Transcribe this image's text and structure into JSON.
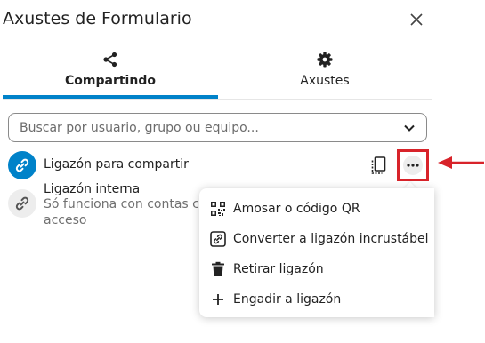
{
  "header": {
    "title": "Axustes de Formulario"
  },
  "tabs": [
    {
      "label": "Compartindo",
      "icon": "share-icon",
      "active": true
    },
    {
      "label": "Axustes",
      "icon": "gear-icon",
      "active": false
    }
  ],
  "search": {
    "placeholder": "Buscar por usuario, grupo ou equipo..."
  },
  "share_link": {
    "title": "Ligazón para compartir"
  },
  "internal_link": {
    "title": "Ligazón interna",
    "subtitle_line1": "Só funciona con contas co",
    "subtitle_line2": "acceso"
  },
  "menu": {
    "items": [
      {
        "label": "Amosar o código QR",
        "icon": "qr-code-icon"
      },
      {
        "label": "Converter a ligazón incrustábel",
        "icon": "embed-link-icon"
      },
      {
        "label": "Retirar ligazón",
        "icon": "trash-icon"
      },
      {
        "label": "Engadir a ligazón",
        "icon": "plus-icon"
      }
    ]
  },
  "colors": {
    "accent": "#0082c9",
    "highlight": "#d8232a",
    "text": "#222222",
    "muted": "#707070"
  }
}
